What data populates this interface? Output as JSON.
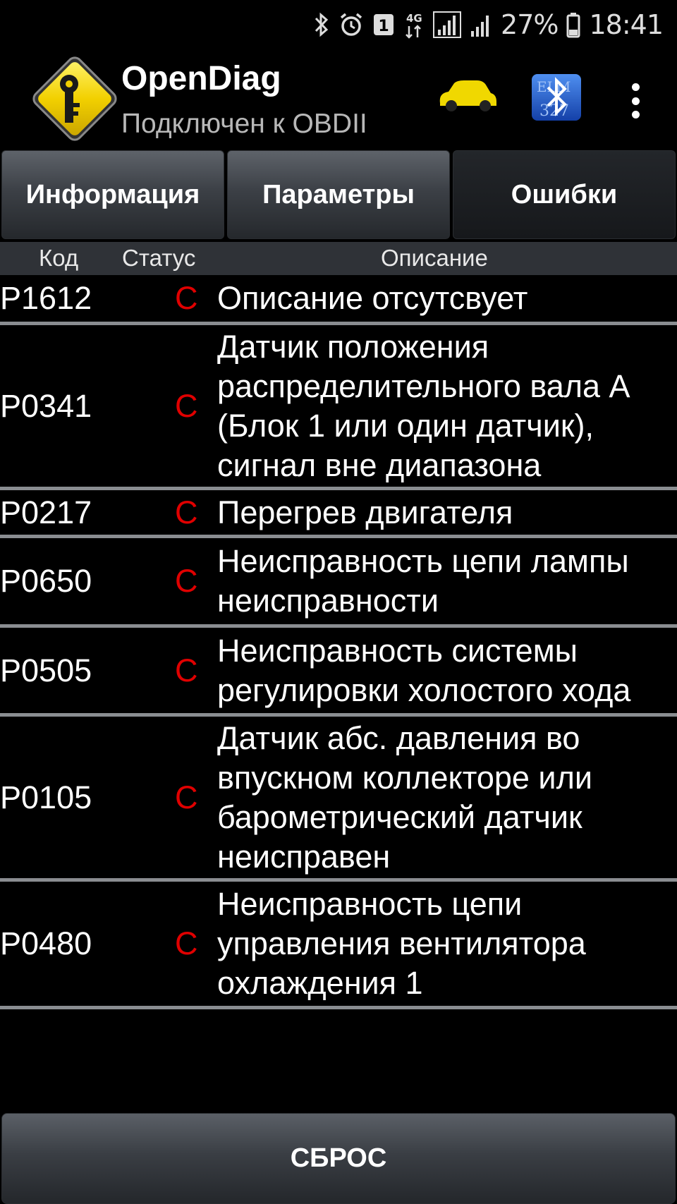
{
  "status_bar": {
    "bluetooth_icon": "bluetooth-icon",
    "alarm_icon": "alarm-icon",
    "sim_badge": "1",
    "network_type": "4G",
    "battery_percent": "27%",
    "time": "18:41"
  },
  "app": {
    "title": "OpenDiag",
    "subtitle": "Подключен к OBDII",
    "logo_icon": "key-diamond-logo",
    "car_icon": "car-icon",
    "bluetooth_adapter_icon": "elm327-bluetooth-icon",
    "menu_icon": "more-vert-icon"
  },
  "tabs": [
    {
      "label": "Информация",
      "active": false
    },
    {
      "label": "Параметры",
      "active": false
    },
    {
      "label": "Ошибки",
      "active": true
    }
  ],
  "table": {
    "headers": {
      "code": "Код",
      "status": "Статус",
      "description": "Описание"
    },
    "rows": [
      {
        "code": "P1612",
        "status": "C",
        "description": "Описание отсутсвует"
      },
      {
        "code": "P0341",
        "status": "C",
        "description": "Датчик положения распределительного вала A (Блок 1 или один датчик), сигнал вне диапазона"
      },
      {
        "code": "P0217",
        "status": "C",
        "description": "Перегрев двигателя"
      },
      {
        "code": "P0650",
        "status": "C",
        "description": "Неисправность цепи лампы неисправности"
      },
      {
        "code": "P0505",
        "status": "C",
        "description": "Неисправность системы регулировки холостого хода"
      },
      {
        "code": "P0105",
        "status": "C",
        "description": "Датчик абс. давления во впускном коллекторе или барометрический датчик неисправен"
      },
      {
        "code": "P0480",
        "status": "C",
        "description": "Неисправность цепи управления вентилятора охлаждения 1"
      }
    ]
  },
  "reset_button": {
    "label": "СБРОС"
  },
  "colors": {
    "status_error": "#e00000",
    "logo_yellow": "#f2d000",
    "car_yellow": "#f0d800",
    "bluetooth_blue": "#1e5fd0"
  }
}
